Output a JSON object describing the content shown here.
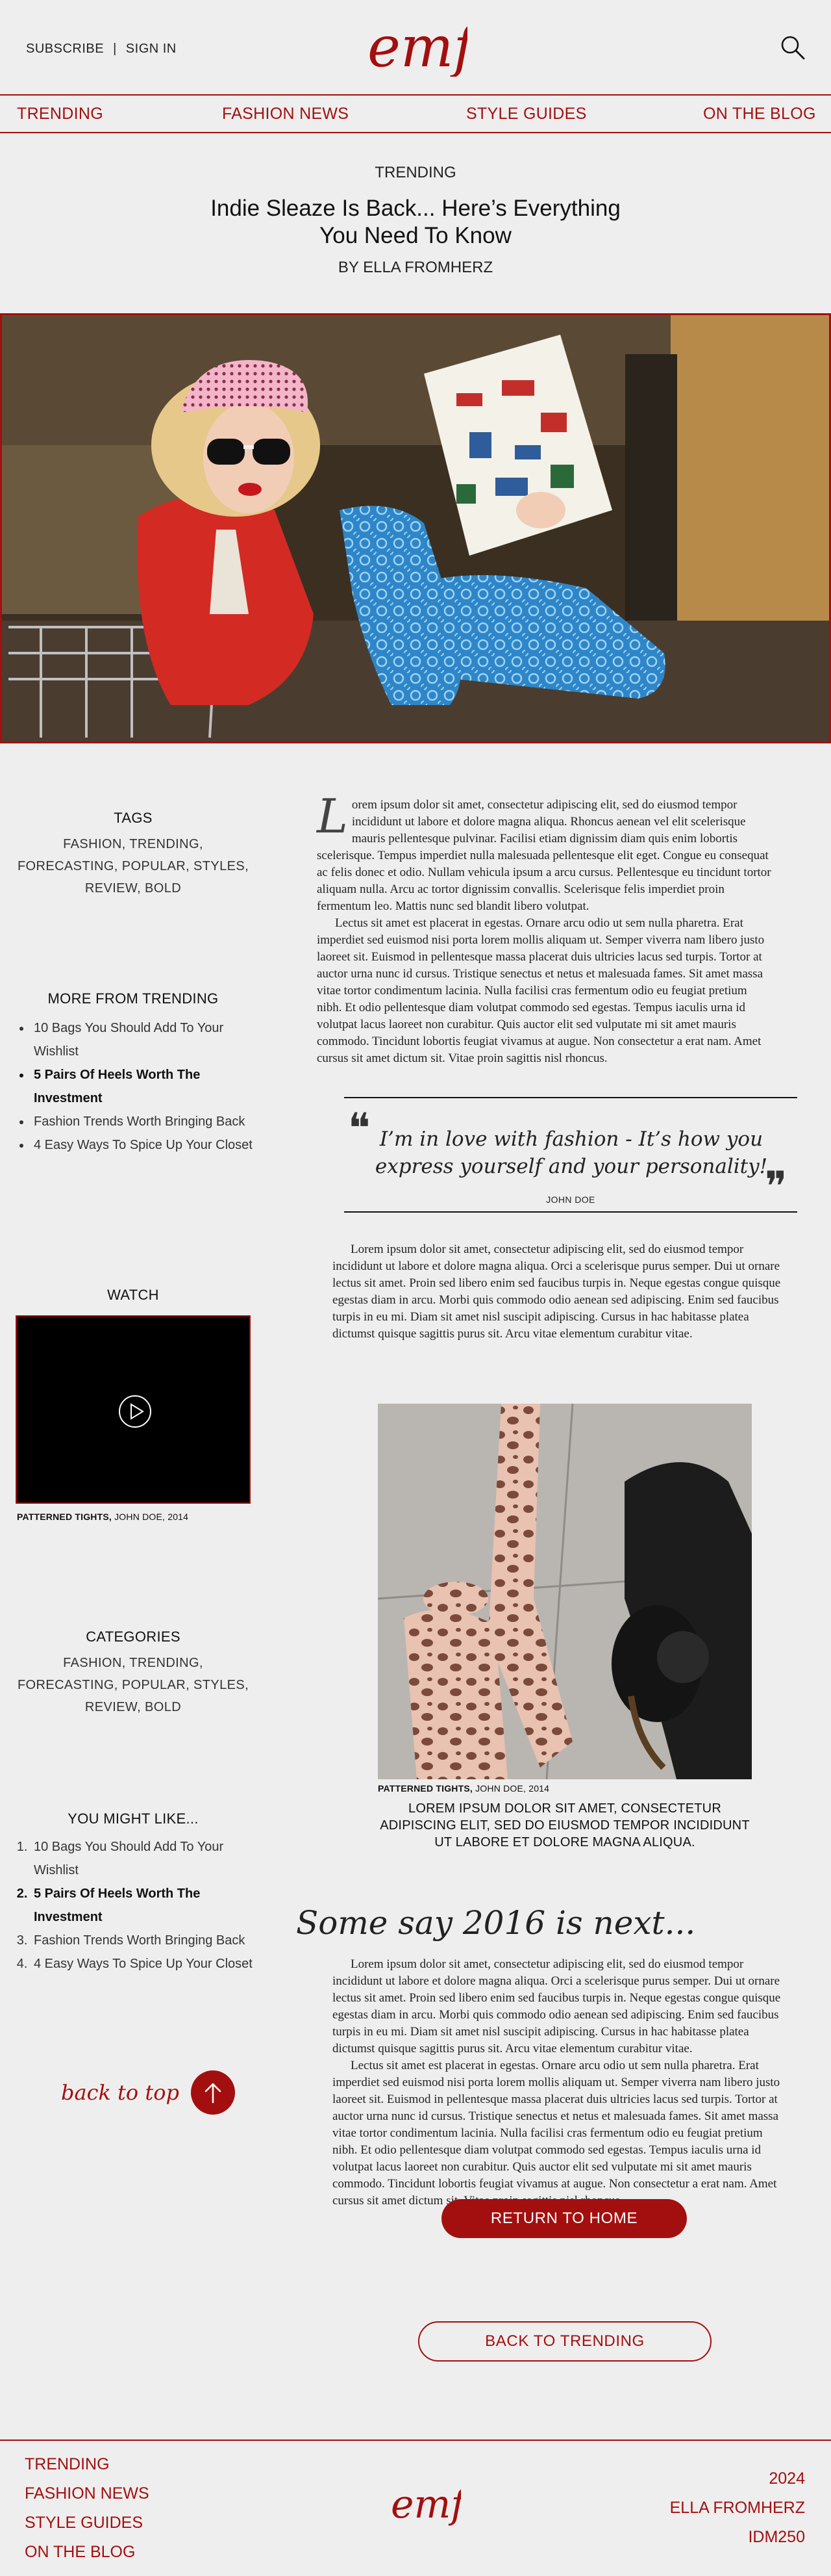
{
  "header": {
    "subscribe": "SUBSCRIBE",
    "separator": "|",
    "sign_in": "SIGN IN",
    "logo_text": "emf"
  },
  "nav": {
    "items": [
      "TRENDING",
      "FASHION NEWS",
      "STYLE GUIDES",
      "ON THE BLOG"
    ]
  },
  "article": {
    "kicker": "TRENDING",
    "title_line1": "Indie Sleaze Is Back... Here’s Everything",
    "title_line2": "You Need To Know",
    "byline": "BY ELLA FROMHERZ",
    "dropcap": "L",
    "p1": "orem ipsum dolor sit amet, consectetur adipiscing elit, sed do eiusmod tempor incididunt ut labore et dolore magna aliqua. Rhoncus aenean vel elit scelerisque mauris pellentesque pulvinar. Facilisi etiam dignissim diam quis enim lobortis scelerisque. Tempus imperdiet nulla malesuada pellentesque elit eget. Congue eu consequat ac felis donec et odio. Nullam vehicula ipsum a arcu cursus. Pellentesque eu tincidunt tortor aliquam nulla. Arcu ac tortor dignissim convallis. Scelerisque felis imperdiet proin fermentum leo. Mattis nunc sed blandit libero volutpat.",
    "p2": "Lectus sit amet est placerat in egestas. Ornare arcu odio ut sem nulla pharetra. Erat imperdiet sed euismod nisi porta lorem mollis aliquam ut. Semper viverra nam libero justo laoreet sit. Euismod in pellentesque massa placerat duis ultricies lacus sed turpis. Tortor at auctor urna nunc id cursus. Tristique senectus et netus et malesuada fames. Sit amet massa vitae tortor condimentum lacinia. Nulla facilisi cras fermentum odio eu feugiat pretium nibh. Et odio pellentesque diam volutpat commodo sed egestas. Tempus iaculis urna id volutpat lacus laoreet non curabitur. Quis auctor elit sed vulputate mi sit amet mauris commodo. Tincidunt lobortis feugiat vivamus at augue. Non consectetur a erat nam. Amet cursus sit amet dictum sit. Vitae proin sagittis nisl rhoncus.",
    "quote": "I’m in love with fashion - It’s how you express yourself and your personality!",
    "quote_author": "JOHN DOE",
    "p3": "Lorem ipsum dolor sit amet, consectetur adipiscing elit, sed do eiusmod tempor incididunt ut labore et dolore magna aliqua. Orci a scelerisque purus semper. Dui ut ornare lectus sit amet. Proin sed libero enim sed faucibus turpis in. Neque egestas congue quisque egestas diam in arcu. Morbi quis commodo odio aenean sed adipiscing. Enim sed faucibus turpis in eu mi. Diam sit amet nisl suscipit adipiscing. Cursus in hac habitasse platea dictumst quisque sagittis purus sit. Arcu vitae elementum curabitur vitae.",
    "photo_caption_bold": "PATTERNED TIGHTS,",
    "photo_caption_rest": " JOHN DOE, 2014",
    "photo_upper_caption": "LOREM IPSUM DOLOR SIT AMET, CONSECTETUR ADIPISCING ELIT, SED DO EIUSMOD TEMPOR INCIDIDUNT UT LABORE ET DOLORE MAGNA ALIQUA.",
    "section_heading": "Some say 2016 is next...",
    "p4": "Lorem ipsum dolor sit amet, consectetur adipiscing elit, sed do eiusmod tempor incididunt ut labore et dolore magna aliqua. Orci a scelerisque purus semper. Dui ut ornare lectus sit amet. Proin sed libero enim sed faucibus turpis in. Neque egestas congue quisque egestas diam in arcu. Morbi quis commodo odio aenean sed adipiscing. Enim sed faucibus turpis in eu mi. Diam sit amet nisl suscipit adipiscing. Cursus in hac habitasse platea dictumst quisque sagittis purus sit. Arcu vitae elementum curabitur vitae.",
    "p5": "Lectus sit amet est placerat in egestas. Ornare arcu odio ut sem nulla pharetra. Erat imperdiet sed euismod nisi porta lorem mollis aliquam ut. Semper viverra nam libero justo laoreet sit. Euismod in pellentesque massa placerat duis ultricies lacus sed turpis. Tortor at auctor urna nunc id cursus. Tristique senectus et netus et malesuada fames. Sit amet massa vitae tortor condimentum lacinia. Nulla facilisi cras fermentum odio eu feugiat pretium nibh. Et odio pellentesque diam volutpat commodo sed egestas. Tempus iaculis urna id volutpat lacus laoreet non curabitur. Quis auctor elit sed vulputate mi sit amet mauris commodo. Tincidunt lobortis feugiat vivamus at augue. Non consectetur a erat nam. Amet cursus sit amet dictum sit. Vitae proin sagittis nisl rhoncus."
  },
  "sidebar": {
    "tags_heading": "TAGS",
    "tags": "FASHION, TRENDING, FORECASTING, POPULAR, STYLES, REVIEW, BOLD",
    "more_heading": "MORE FROM TRENDING",
    "more_items": [
      "10 Bags You Should Add To Your Wishlist",
      "5 Pairs Of Heels Worth The Investment",
      "Fashion Trends Worth Bringing Back",
      "4 Easy Ways To Spice Up Your Closet"
    ],
    "watch_heading": "WATCH",
    "video_caption_bold": "PATTERNED TIGHTS,",
    "video_caption_rest": " JOHN DOE, 2014",
    "categories_heading": "CATEGORIES",
    "categories": "FASHION, TRENDING, FORECASTING, POPULAR, STYLES, REVIEW, BOLD",
    "like_heading": "YOU MIGHT LIKE...",
    "like_items": [
      "10 Bags You Should Add To Your Wishlist",
      "5 Pairs Of Heels Worth The Investment",
      "Fashion Trends Worth Bringing Back",
      "4 Easy Ways To Spice Up Your Closet"
    ],
    "back_to_top": "back to top"
  },
  "buttons": {
    "return_home": "RETURN TO HOME",
    "back_trending": "BACK TO TRENDING"
  },
  "footer": {
    "links": [
      "TRENDING",
      "FASHION NEWS",
      "STYLE GUIDES",
      "ON THE BLOG"
    ],
    "year": "2024",
    "author": "ELLA FROMHERZ",
    "code": "IDM250"
  },
  "colors": {
    "accent": "#a30f0f",
    "background": "#efeeee"
  }
}
